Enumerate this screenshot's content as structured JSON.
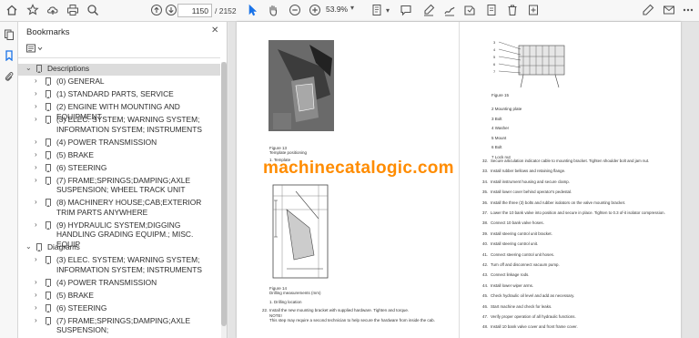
{
  "toolbar": {
    "page_current": "1150",
    "page_total": "/ 2152",
    "zoom": "53.9%",
    "icons": [
      "home-icon",
      "bookmark-star-icon",
      "upload-icon",
      "print-icon",
      "search-icon",
      "scroll-up-icon",
      "scroll-down-icon",
      "select-cursor-icon",
      "hand-icon",
      "zoom-out-icon",
      "zoom-in-icon",
      "fit-page-icon",
      "highlight-icon",
      "sign-icon",
      "comment-icon",
      "draw-icon",
      "delete-icon",
      "page-icon",
      "edit-icon",
      "more-icon"
    ]
  },
  "bookmarks": {
    "title": "Bookmarks",
    "items": [
      {
        "label": "Descriptions",
        "level": 0,
        "expanded": true,
        "selected": true
      },
      {
        "label": "(0) GENERAL",
        "level": 1
      },
      {
        "label": "(1) STANDARD PARTS, SERVICE",
        "level": 1
      },
      {
        "label": "(2) ENGINE WITH MOUNTING AND EQUIPMENT",
        "level": 1
      },
      {
        "label": "(3) ELEC. SYSTEM; WARNING SYSTEM; INFORMATION SYSTEM; INSTRUMENTS",
        "level": 1
      },
      {
        "label": "(4) POWER TRANSMISSION",
        "level": 1
      },
      {
        "label": "(5) BRAKE",
        "level": 1
      },
      {
        "label": "(6) STEERING",
        "level": 1
      },
      {
        "label": "(7) FRAME;SPRINGS;DAMPING;AXLE SUSPENSION; WHEEL TRACK UNIT",
        "level": 1
      },
      {
        "label": "(8) MACHINERY HOUSE;CAB;EXTERIOR TRIM PARTS ANYWHERE",
        "level": 1
      },
      {
        "label": "(9) HYDRAULIC SYSTEM;DIGGING HANDLING GRADING EQUIPM.; MISC. EQUIP",
        "level": 1
      },
      {
        "label": "Diagrams",
        "level": 0,
        "expanded": true
      },
      {
        "label": "(3) ELEC. SYSTEM; WARNING SYSTEM; INFORMATION SYSTEM; INSTRUMENTS",
        "level": 1
      },
      {
        "label": "(4) POWER TRANSMISSION",
        "level": 1
      },
      {
        "label": "(5) BRAKE",
        "level": 1
      },
      {
        "label": "(6) STEERING",
        "level": 1
      },
      {
        "label": "(7) FRAME;SPRINGS;DAMPING;AXLE SUSPENSION;",
        "level": 1
      }
    ]
  },
  "document": {
    "watermark": "machinecatalogic.com",
    "left": {
      "fig13_caption": "Figure 13",
      "fig13_sub": "Template positioning",
      "fig13_item": "1.        Template",
      "fig14_caption": "Figure 14",
      "fig14_sub": "Drilling measurements (mm)",
      "fig14_item": "1.        Drilling location",
      "step22": "Install the new mounting bracket with supplied hardware. Tighten and torque.",
      "note": "NOTE!",
      "note_text": "This step may require a second technician to help secure the hardware from inside the cab.",
      "step22_num": "22."
    },
    "right": {
      "fig15_caption": "Figure 15",
      "legend": [
        "2 Mounting plate",
        "3 Bolt",
        "4 Washer",
        "5 Mount",
        "6 Bolt",
        "7 Lock nut"
      ],
      "steps": [
        {
          "num": "32.",
          "text": "Secure articulation indicator cable to mounting bracket. Tighten shoulder bolt and jam nut."
        },
        {
          "num": "33.",
          "text": "Install rubber bellows and retaining flange."
        },
        {
          "num": "34.",
          "text": "Install instrument housing and secure clamp."
        },
        {
          "num": "35.",
          "text": "Install lower cover behind operator's pedestal."
        },
        {
          "num": "36.",
          "text": "Install the three (3) bolts and rubber isolators on the valve mounting bracket."
        },
        {
          "num": "37.",
          "text": "Lower the 10 bank valve into position and secure in place. Tighten to 0.3 of-it isolator compression."
        },
        {
          "num": "38.",
          "text": "Connect 10 bank valve hoses."
        },
        {
          "num": "39.",
          "text": "Install steering control unit bracket."
        },
        {
          "num": "40.",
          "text": "Install steering control unit."
        },
        {
          "num": "41.",
          "text": "Connect steering control unit hoses."
        },
        {
          "num": "42.",
          "text": "Turn off and disconnect vacuum pump."
        },
        {
          "num": "43.",
          "text": "Connect linkage rods."
        },
        {
          "num": "44.",
          "text": "Install lower wiper arms."
        },
        {
          "num": "45.",
          "text": "Check hydraulic oil level and add as necessary."
        },
        {
          "num": "46.",
          "text": "Start machine and check for leaks."
        },
        {
          "num": "47.",
          "text": "Verify proper operation of all hydraulic functions."
        },
        {
          "num": "48.",
          "text": "Install 10 bank valve cover and front frame cover."
        }
      ]
    }
  }
}
